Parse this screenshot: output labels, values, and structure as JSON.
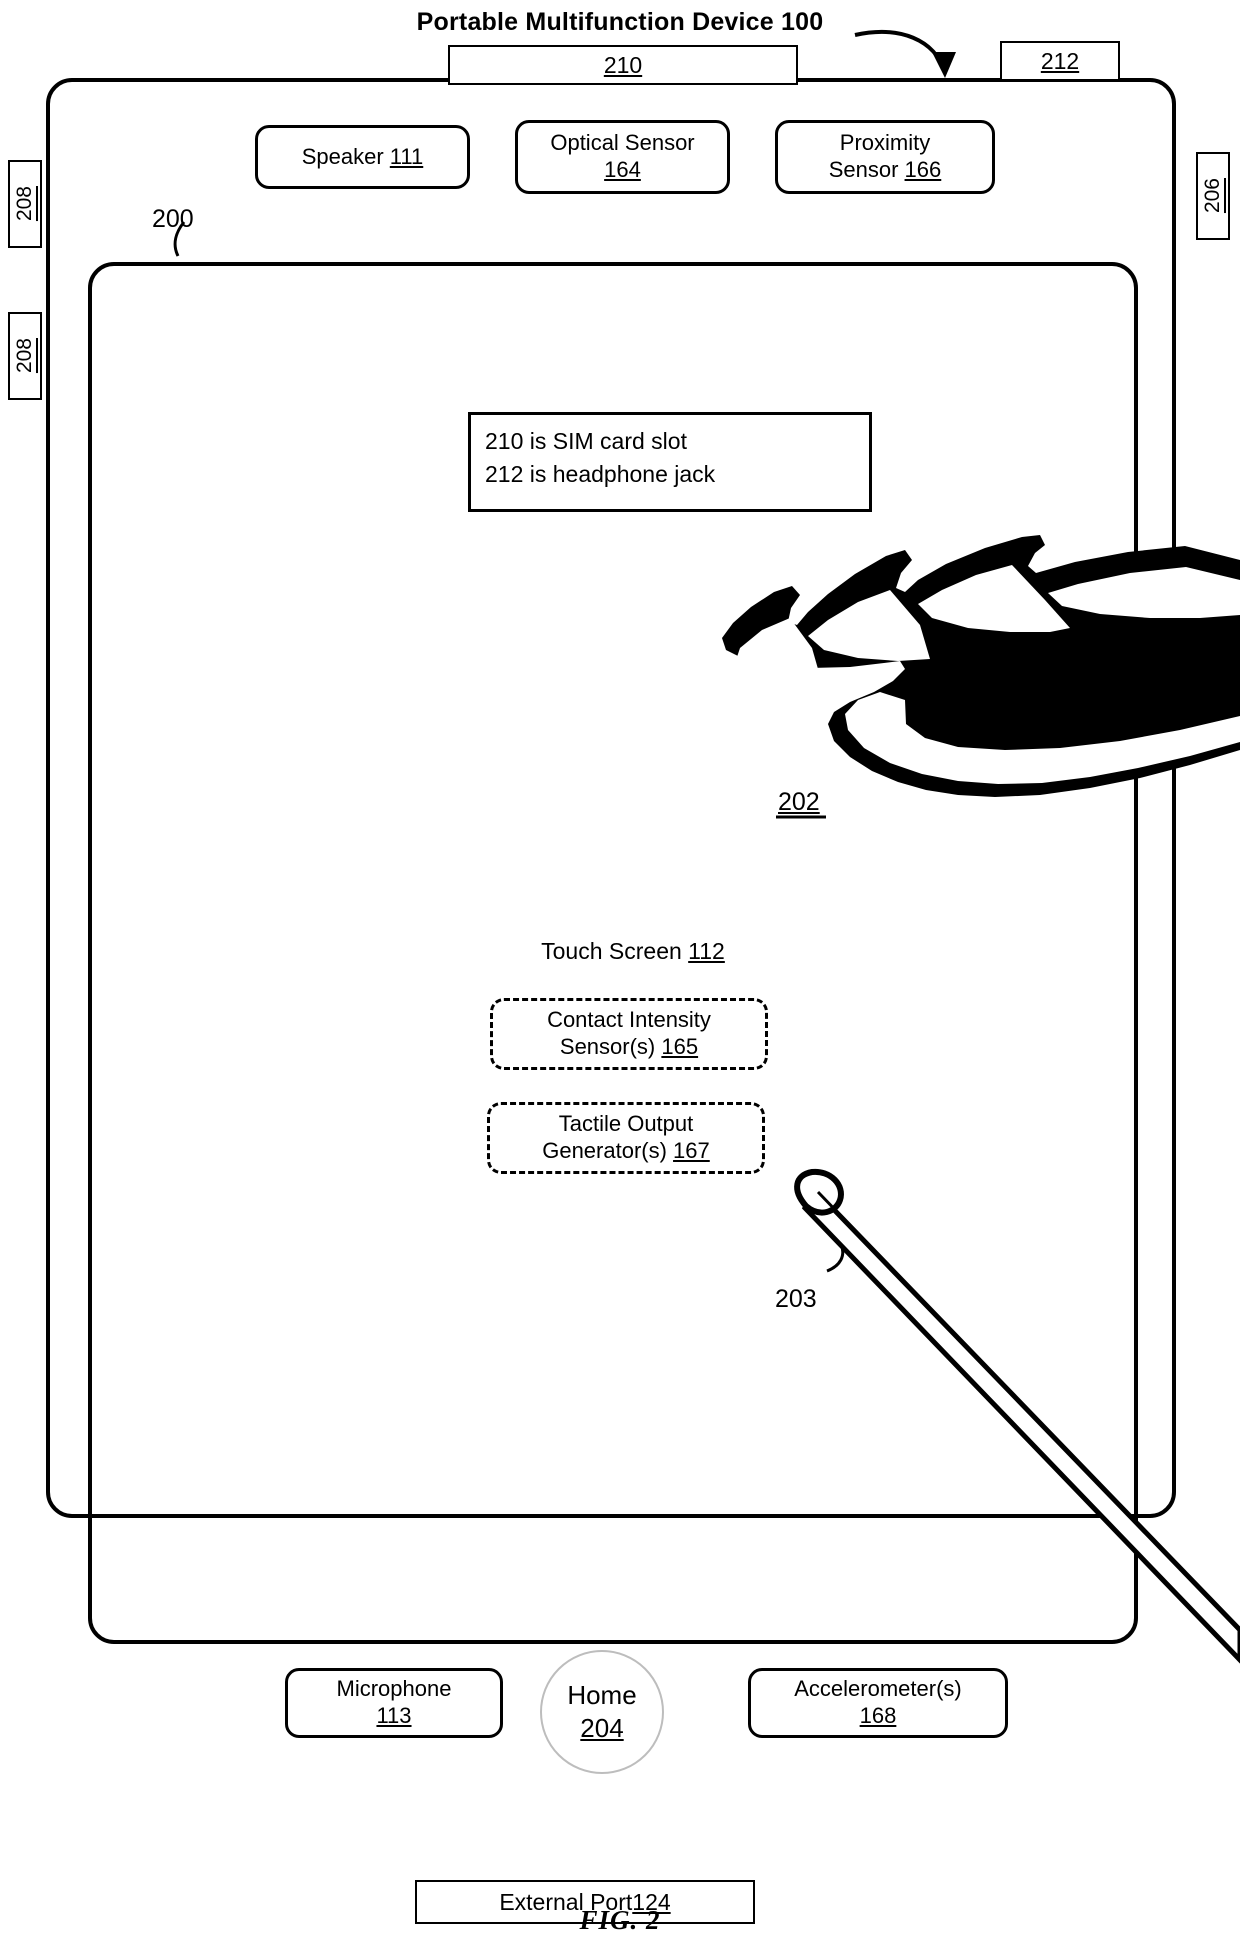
{
  "figure": {
    "title": "Portable Multifunction Device 100",
    "caption": "FIG. 2"
  },
  "top_tabs": [
    {
      "name": "sim-card-slot-tab",
      "label": "210"
    },
    {
      "name": "headphone-jack-tab",
      "label": "212"
    }
  ],
  "side_tabs": [
    {
      "name": "side-tab-208-upper",
      "label": "208"
    },
    {
      "name": "side-tab-208-lower",
      "label": "208"
    },
    {
      "name": "side-tab-206",
      "label": "206"
    }
  ],
  "sensors": {
    "speaker": {
      "text": "Speaker ",
      "number": "111"
    },
    "optical": {
      "text": "Optical Sensor",
      "number": "164"
    },
    "proximity": {
      "text_line1": "Proximity",
      "text_line2": "Sensor ",
      "number": "166"
    }
  },
  "note_box": {
    "line1": "210 is SIM card slot",
    "line2": "212 is headphone jack"
  },
  "touch_screen": {
    "label": "Touch Screen ",
    "number": "112"
  },
  "dashed_boxes": {
    "contact_intensity": {
      "line1": "Contact Intensity",
      "line2": "Sensor(s) ",
      "number": "165"
    },
    "tactile_output": {
      "line1": "Tactile Output",
      "line2": "Generator(s) ",
      "number": "167"
    }
  },
  "bottom": {
    "microphone": {
      "text": "Microphone",
      "number": "113"
    },
    "home": {
      "text": "Home",
      "number": "204"
    },
    "accelerometer": {
      "text": "Accelerometer(s)",
      "number": "168"
    },
    "external_port": {
      "text": "External Port ",
      "number": "124"
    }
  },
  "reference_numerals": {
    "device_screen": "200",
    "finger_contact": "202",
    "stylus": "203"
  },
  "colors": {
    "line": "#000000",
    "background": "#ffffff",
    "home_button_outline": "#bdbdbd"
  }
}
